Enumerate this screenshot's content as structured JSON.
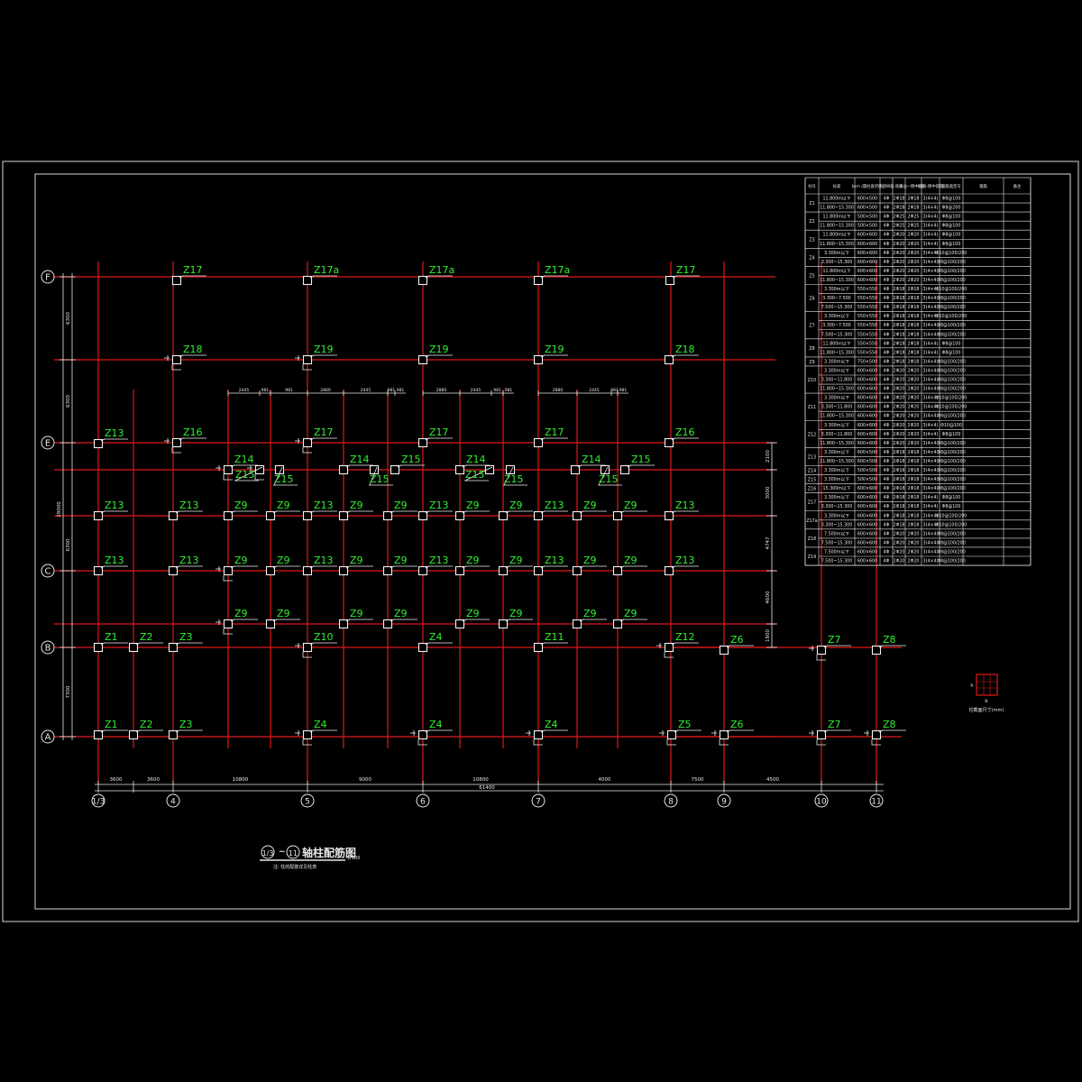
{
  "drawing": {
    "title_prefix": "1/3",
    "title_tilde": "~",
    "title_end": "11",
    "title_text": "轴柱配筋图",
    "scale": "1/100",
    "note": "注: 柱的配筋详见柱表",
    "legend_caption": "柱截面尺寸(mm)"
  },
  "row_axes": [
    {
      "name": "F"
    },
    {
      "name": "E"
    },
    {
      "name": "C"
    },
    {
      "name": "B"
    },
    {
      "name": "A"
    }
  ],
  "col_axes": [
    {
      "name": "1/3"
    },
    {
      "name": "4"
    },
    {
      "name": "5"
    },
    {
      "name": "6"
    },
    {
      "name": "7"
    },
    {
      "name": "8"
    },
    {
      "name": "9"
    },
    {
      "name": "10"
    },
    {
      "name": "11"
    }
  ],
  "bottom_dims": [
    "3600",
    "3600",
    "10800",
    "9000",
    "10800",
    "4000",
    "7500",
    "4500"
  ],
  "bottom_total": "61400",
  "left_dims": [
    "6300",
    "6300",
    "6300",
    "7300"
  ],
  "left_total": "28000",
  "right_dims": [
    "2100",
    "3000",
    "4747",
    "4600",
    "1800"
  ],
  "top_dims": [
    [
      "2445",
      "981",
      "981",
      "2880",
      "2445",
      "981",
      "981"
    ],
    [
      "2880",
      "2445",
      "981",
      "981"
    ],
    [
      "2880",
      "2445",
      "981",
      "981"
    ]
  ],
  "columns": [
    {
      "label": "Z17"
    },
    {
      "label": "Z17a"
    },
    {
      "label": "Z17a"
    },
    {
      "label": "Z17a"
    },
    {
      "label": "Z17"
    },
    {
      "label": "Z18"
    },
    {
      "label": "Z19"
    },
    {
      "label": "Z19"
    },
    {
      "label": "Z19"
    },
    {
      "label": "Z18"
    },
    {
      "label": "Z13"
    },
    {
      "label": "Z16"
    },
    {
      "label": "Z17"
    },
    {
      "label": "Z17"
    },
    {
      "label": "Z17"
    },
    {
      "label": "Z16"
    },
    {
      "label": "Z14"
    },
    {
      "label": "Z15"
    },
    {
      "label": "Z15"
    },
    {
      "label": "Z14"
    },
    {
      "label": "Z15"
    },
    {
      "label": "Z15"
    },
    {
      "label": "Z14"
    },
    {
      "label": "Z15"
    },
    {
      "label": "Z15"
    },
    {
      "label": "Z14"
    },
    {
      "label": "Z15"
    },
    {
      "label": "Z15"
    },
    {
      "label": "Z13"
    },
    {
      "label": "Z13"
    },
    {
      "label": "Z9"
    },
    {
      "label": "Z9"
    },
    {
      "label": "Z13"
    },
    {
      "label": "Z9"
    },
    {
      "label": "Z9"
    },
    {
      "label": "Z13"
    },
    {
      "label": "Z9"
    },
    {
      "label": "Z9"
    },
    {
      "label": "Z13"
    },
    {
      "label": "Z9"
    },
    {
      "label": "Z9"
    },
    {
      "label": "Z13"
    },
    {
      "label": "Z13"
    },
    {
      "label": "Z13"
    },
    {
      "label": "Z9"
    },
    {
      "label": "Z9"
    },
    {
      "label": "Z13"
    },
    {
      "label": "Z9"
    },
    {
      "label": "Z9"
    },
    {
      "label": "Z13"
    },
    {
      "label": "Z9"
    },
    {
      "label": "Z9"
    },
    {
      "label": "Z13"
    },
    {
      "label": "Z9"
    },
    {
      "label": "Z9"
    },
    {
      "label": "Z13"
    },
    {
      "label": "Z9"
    },
    {
      "label": "Z9"
    },
    {
      "label": "Z9"
    },
    {
      "label": "Z9"
    },
    {
      "label": "Z9"
    },
    {
      "label": "Z9"
    },
    {
      "label": "Z9"
    },
    {
      "label": "Z9"
    },
    {
      "label": "Z1"
    },
    {
      "label": "Z2"
    },
    {
      "label": "Z3"
    },
    {
      "label": "Z10"
    },
    {
      "label": "Z4"
    },
    {
      "label": "Z11"
    },
    {
      "label": "Z12"
    },
    {
      "label": "Z6"
    },
    {
      "label": "Z7"
    },
    {
      "label": "Z8"
    },
    {
      "label": "Z1"
    },
    {
      "label": "Z2"
    },
    {
      "label": "Z3"
    },
    {
      "label": "Z4"
    },
    {
      "label": "Z4"
    },
    {
      "label": "Z4"
    },
    {
      "label": "Z5"
    },
    {
      "label": "Z6"
    },
    {
      "label": "Z7"
    },
    {
      "label": "Z8"
    }
  ],
  "table": {
    "headers": [
      "柱号",
      "标高",
      "b×h (圆柱直径D)",
      "全部纵筋",
      "角筋",
      "b边一侧中部筋",
      "h边一侧中部筋",
      "箍筋类型号",
      "箍筋",
      "备注"
    ],
    "groups": [
      {
        "id": "Z1",
        "rows": [
          [
            "11.800m以下",
            "600×500",
            "4Φ",
            "2Φ18",
            "2Φ18",
            "3(4×4)",
            "Φ8@100"
          ],
          [
            "11.800~15.300",
            "600×500",
            "4Φ",
            "2Φ18",
            "2Φ18",
            "3(4×4)",
            "Φ8@200"
          ]
        ]
      },
      {
        "id": "Z2",
        "rows": [
          [
            "11.800m以下",
            "500×500",
            "4Φ",
            "2Φ25",
            "2Φ25",
            "3(4×4)",
            "Φ8@100"
          ],
          [
            "11.800~15.300",
            "500×500",
            "4Φ",
            "2Φ25",
            "2Φ25",
            "3(4×4)",
            "Φ8@100"
          ]
        ]
      },
      {
        "id": "Z3",
        "rows": [
          [
            "11.800m以下",
            "600×600",
            "4Φ",
            "2Φ20",
            "2Φ20",
            "3(4×4)",
            "Φ8@100"
          ],
          [
            "11.800~15.300",
            "600×600",
            "4Φ",
            "2Φ20",
            "2Φ20",
            "3(4×4)",
            "Φ8@100"
          ]
        ]
      },
      {
        "id": "Z4",
        "rows": [
          [
            "3.300m以下",
            "600×600",
            "4Φ",
            "2Φ20",
            "2Φ20",
            "3(4×4)",
            "Φ10@100/200"
          ],
          [
            "3.300~15.300",
            "600×600",
            "4Φ",
            "2Φ20",
            "2Φ20",
            "3(4×4)",
            "Φ8@100/200"
          ]
        ]
      },
      {
        "id": "Z5",
        "rows": [
          [
            "11.800m以下",
            "600×600",
            "4Φ",
            "2Φ20",
            "2Φ20",
            "3(4×4)",
            "Φ8@100/200"
          ],
          [
            "11.800~15.300",
            "600×600",
            "4Φ",
            "2Φ20",
            "2Φ20",
            "3(4×4)",
            "Φ8@100/200"
          ]
        ]
      },
      {
        "id": "Z6",
        "rows": [
          [
            "3.300m以下",
            "550×550",
            "4Φ",
            "2Φ18",
            "2Φ18",
            "3(4×4)",
            "Φ10@100/200"
          ],
          [
            "3.300~7.500",
            "550×550",
            "4Φ",
            "2Φ18",
            "2Φ18",
            "3(4×4)",
            "Φ8@100/200"
          ],
          [
            "7.500~15.300",
            "550×550",
            "4Φ",
            "2Φ18",
            "2Φ18",
            "3(4×4)",
            "Φ8@100/200"
          ]
        ]
      },
      {
        "id": "Z7",
        "rows": [
          [
            "3.300m以下",
            "550×550",
            "4Φ",
            "2Φ18",
            "2Φ18",
            "3(4×4)",
            "Φ10@100/200"
          ],
          [
            "3.300~7.500",
            "550×550",
            "4Φ",
            "2Φ18",
            "2Φ18",
            "3(4×4)",
            "Φ8@100/200"
          ],
          [
            "7.500~15.300",
            "550×550",
            "4Φ",
            "2Φ18",
            "2Φ18",
            "3(4×4)",
            "Φ8@100/200"
          ]
        ]
      },
      {
        "id": "Z8",
        "rows": [
          [
            "11.800m以下",
            "550×550",
            "4Φ",
            "2Φ18",
            "2Φ18",
            "3(4×4)",
            "Φ8@100"
          ],
          [
            "11.800~15.300",
            "550×550",
            "4Φ",
            "2Φ18",
            "2Φ18",
            "3(4×4)",
            "Φ8@100"
          ]
        ]
      },
      {
        "id": "Z9",
        "rows": [
          [
            "3.300m以下",
            "750×500",
            "4Φ",
            "2Φ18",
            "2Φ18",
            "3(4×4)",
            "Φ8@100/200"
          ]
        ]
      },
      {
        "id": "Z10",
        "rows": [
          [
            "3.300m以下",
            "600×600",
            "4Φ",
            "2Φ20",
            "2Φ20",
            "3(4×4)",
            "Φ8@100/200"
          ],
          [
            "3.300~11.800",
            "600×600",
            "4Φ",
            "2Φ20",
            "2Φ20",
            "3(4×4)",
            "Φ8@100/200"
          ],
          [
            "11.800~15.300",
            "600×600",
            "4Φ",
            "2Φ20",
            "2Φ20",
            "3(4×4)",
            "Φ8@100/200"
          ]
        ]
      },
      {
        "id": "Z11",
        "rows": [
          [
            "3.300m以下",
            "600×600",
            "4Φ",
            "2Φ20",
            "2Φ20",
            "3(4×4)",
            "Φ10@100/200"
          ],
          [
            "3.300~11.800",
            "600×600",
            "4Φ",
            "2Φ20",
            "2Φ20",
            "3(4×4)",
            "Φ10@100/200"
          ],
          [
            "11.800~15.300",
            "600×600",
            "4Φ",
            "2Φ20",
            "2Φ20",
            "3(4×4)",
            "Φ8@100/200"
          ]
        ]
      },
      {
        "id": "Z12",
        "rows": [
          [
            "3.300m以下",
            "600×600",
            "4Φ",
            "2Φ20",
            "2Φ20",
            "3(4×4)",
            "Φ10@100"
          ],
          [
            "3.300~11.800",
            "600×600",
            "4Φ",
            "2Φ20",
            "2Φ20",
            "3(4×4)",
            "Φ8@100"
          ],
          [
            "11.800~15.300",
            "600×600",
            "4Φ",
            "2Φ20",
            "2Φ20",
            "3(4×4)",
            "Φ8@100/200"
          ]
        ]
      },
      {
        "id": "Z13",
        "rows": [
          [
            "3.300m以下",
            "600×500",
            "4Φ",
            "2Φ18",
            "2Φ18",
            "3(4×4)",
            "Φ8@100/200"
          ],
          [
            "11.800~15.300",
            "600×500",
            "4Φ",
            "2Φ18",
            "2Φ18",
            "3(4×4)",
            "Φ8@100/200"
          ]
        ]
      },
      {
        "id": "Z14",
        "rows": [
          [
            "3.300m以下",
            "500×500",
            "4Φ",
            "2Φ18",
            "2Φ18",
            "3(4×4)",
            "Φ8@100/200"
          ]
        ]
      },
      {
        "id": "Z15",
        "rows": [
          [
            "3.300m以下",
            "500×500",
            "4Φ",
            "2Φ18",
            "2Φ18",
            "3(4×4)",
            "Φ8@100/200"
          ]
        ]
      },
      {
        "id": "Z16",
        "rows": [
          [
            "15.300m以下",
            "600×600",
            "4Φ",
            "2Φ18",
            "2Φ18",
            "3(4×4)",
            "Φ8@100/200"
          ]
        ]
      },
      {
        "id": "Z17",
        "rows": [
          [
            "3.300m以下",
            "600×600",
            "4Φ",
            "2Φ18",
            "2Φ18",
            "3(4×4)",
            "Φ8@100"
          ],
          [
            "3.300~15.300",
            "600×600",
            "4Φ",
            "2Φ18",
            "2Φ18",
            "3(4×4)",
            "Φ8@100"
          ]
        ]
      },
      {
        "id": "Z17a",
        "rows": [
          [
            "3.300m以下",
            "600×600",
            "4Φ",
            "2Φ18",
            "2Φ18",
            "3(4×4)",
            "Φ10@100/200"
          ],
          [
            "3.300~15.300",
            "600×600",
            "4Φ",
            "2Φ18",
            "2Φ18",
            "3(4×4)",
            "Φ10@100/200"
          ]
        ]
      },
      {
        "id": "Z18",
        "rows": [
          [
            "7.500m以下",
            "600×600",
            "4Φ",
            "2Φ20",
            "2Φ20",
            "3(4×4)",
            "Φ8@100/200"
          ],
          [
            "7.500~15.300",
            "600×600",
            "4Φ",
            "2Φ20",
            "2Φ20",
            "3(4×4)",
            "Φ8@100/200"
          ]
        ]
      },
      {
        "id": "Z19",
        "rows": [
          [
            "7.500m以下",
            "600×600",
            "4Φ",
            "2Φ20",
            "2Φ20",
            "3(4×4)",
            "Φ8@100/200"
          ],
          [
            "7.500~15.300",
            "600×600",
            "4Φ",
            "2Φ20",
            "2Φ20",
            "3(4×4)",
            "Φ8@100/200"
          ]
        ]
      }
    ]
  }
}
